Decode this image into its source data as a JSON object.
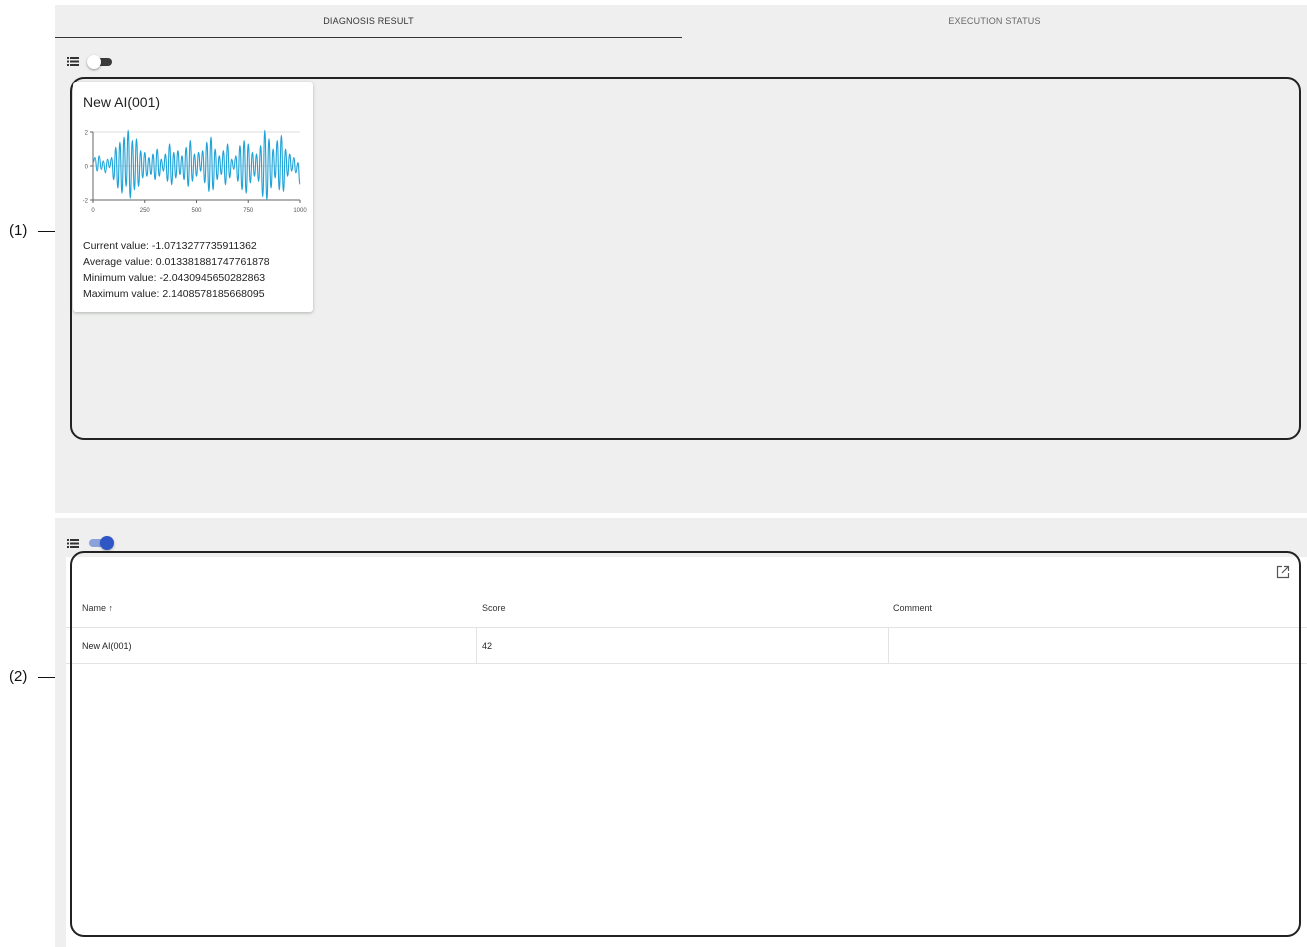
{
  "tabs": [
    {
      "label": "DIAGNOSIS RESULT",
      "active": true
    },
    {
      "label": "EXECUTION STATUS",
      "active": false
    }
  ],
  "callouts": {
    "one": "(1)",
    "two": "(2)"
  },
  "card_view": {
    "view_icon": "list-icon",
    "toggle_on": false,
    "card": {
      "title": "New AI(001)",
      "current_value": "Current value: -1.0713277735911362",
      "average_value": "Average value: 0.013381881747761878",
      "minimum_value": "Minimum value: -2.0430945650282863",
      "maximum_value": "Maximum value: 2.1408578185668095"
    }
  },
  "chart_data": {
    "type": "line",
    "title": "",
    "xlabel": "",
    "ylabel": "",
    "xlim": [
      0,
      1000
    ],
    "ylim": [
      -2,
      2
    ],
    "x_ticks": [
      "0",
      "250",
      "500",
      "750",
      "1000"
    ],
    "y_ticks": [
      "2",
      "0",
      "-2"
    ],
    "grid": true,
    "color": "#1ea2d8",
    "series": [
      {
        "x": [
          0,
          10,
          20,
          30,
          40,
          50,
          60,
          70,
          80,
          90,
          100,
          110,
          120,
          130,
          140,
          150,
          160,
          170,
          180,
          190,
          200,
          210,
          220,
          230,
          240,
          250,
          260,
          270,
          280,
          290,
          300,
          310,
          320,
          330,
          340,
          350,
          360,
          370,
          380,
          390,
          400,
          410,
          420,
          430,
          440,
          450,
          460,
          470,
          480,
          490,
          500,
          510,
          520,
          530,
          540,
          550,
          560,
          570,
          580,
          590,
          600,
          610,
          620,
          630,
          640,
          650,
          660,
          670,
          680,
          690,
          700,
          710,
          720,
          730,
          740,
          750,
          760,
          770,
          780,
          790,
          800,
          810,
          820,
          830,
          840,
          850,
          860,
          870,
          880,
          890,
          900,
          910,
          920,
          930,
          940,
          950,
          960,
          970,
          980,
          990,
          1000
        ],
        "values": [
          0.2,
          0.5,
          -0.3,
          0.6,
          -0.2,
          0.3,
          -0.4,
          0.4,
          -0.1,
          0.5,
          -0.8,
          1.1,
          -1.3,
          1.4,
          -1.6,
          1.7,
          -1.2,
          2.1,
          -1.9,
          1.5,
          -1.4,
          1.6,
          -1.2,
          0.9,
          -0.7,
          0.8,
          -0.6,
          0.5,
          -0.5,
          0.7,
          -0.8,
          1.0,
          -0.6,
          0.4,
          -0.3,
          0.7,
          -0.9,
          1.3,
          -1.1,
          0.8,
          -0.7,
          0.9,
          -0.5,
          0.6,
          -0.8,
          1.1,
          -1.2,
          1.5,
          -0.9,
          0.7,
          -0.6,
          0.8,
          -0.3,
          0.9,
          -1.0,
          1.4,
          -1.5,
          1.7,
          -1.4,
          1.0,
          -0.8,
          0.6,
          -0.5,
          0.9,
          -1.1,
          1.3,
          -0.7,
          0.4,
          -0.2,
          0.6,
          -0.9,
          1.2,
          -1.4,
          1.5,
          -1.6,
          1.3,
          -1.0,
          0.8,
          -0.6,
          0.7,
          -0.9,
          1.2,
          -1.8,
          2.1,
          -2.0,
          1.6,
          -1.3,
          1.0,
          -0.7,
          1.5,
          -1.4,
          1.8,
          -1.5,
          1.0,
          -0.6,
          0.7,
          -0.3,
          0.5,
          -0.4,
          0.2,
          -1.07
        ]
      }
    ]
  },
  "table_view": {
    "view_icon": "list-icon",
    "toggle_on": true,
    "export_icon": "open-in-new-icon",
    "columns": [
      {
        "label": "Name ↑"
      },
      {
        "label": "Score"
      },
      {
        "label": "Comment"
      }
    ],
    "rows": [
      {
        "name": "New AI(001)",
        "score": "42",
        "comment": ""
      }
    ]
  },
  "colors": {
    "background": "#eeefee",
    "line": "#1ea2d8",
    "toggle_on": "#2e57c5"
  }
}
